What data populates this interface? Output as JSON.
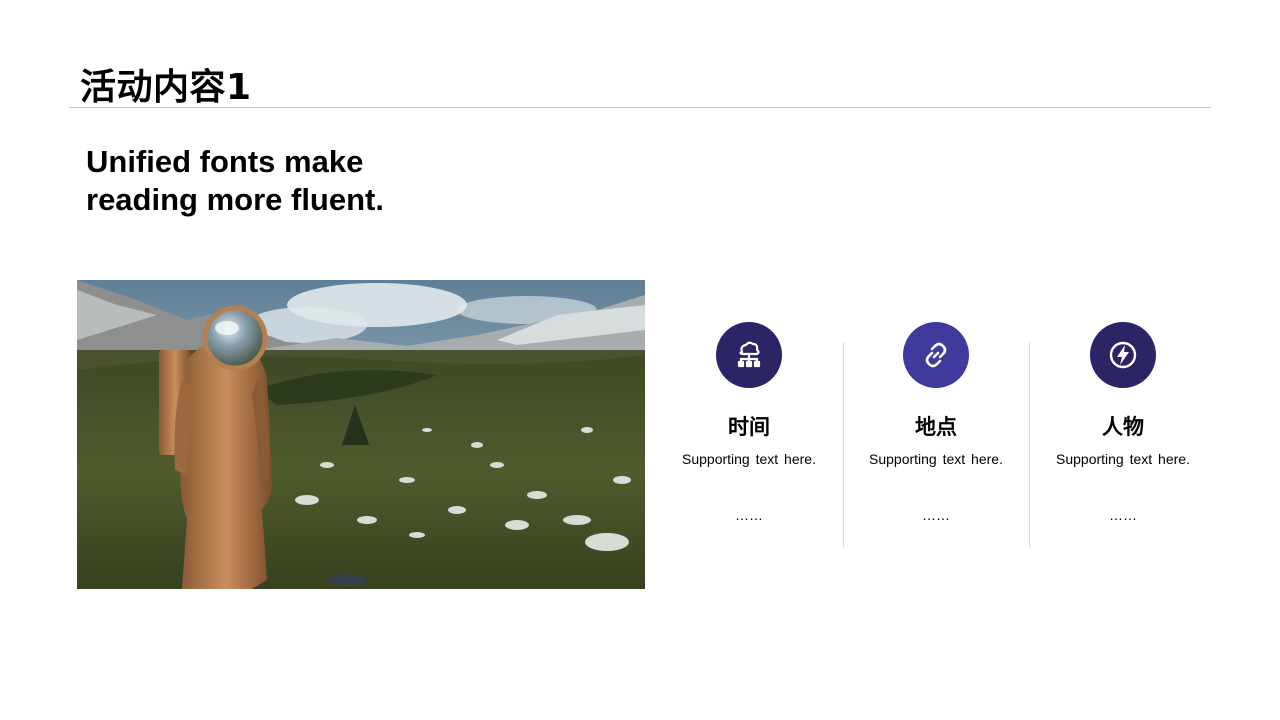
{
  "slide": {
    "title": "活动内容1",
    "headline": "Unified fonts make reading more fluent."
  },
  "columns": [
    {
      "title": "时间",
      "text": "Supporting  text here.",
      "dots": "……",
      "icon": "cloud-network-icon",
      "color": "#2b2566"
    },
    {
      "title": "地点",
      "text": "Supporting  text here.",
      "dots": "……",
      "icon": "link-icon",
      "color": "#3f3a9c"
    },
    {
      "title": "人物",
      "text": "Supporting  text here.",
      "dots": "……",
      "icon": "lightning-icon",
      "color": "#2b2566"
    }
  ],
  "colors": {
    "accent_dark": "#2b2566",
    "accent_mid": "#3f3a9c",
    "divider": "#bfbfbf"
  }
}
